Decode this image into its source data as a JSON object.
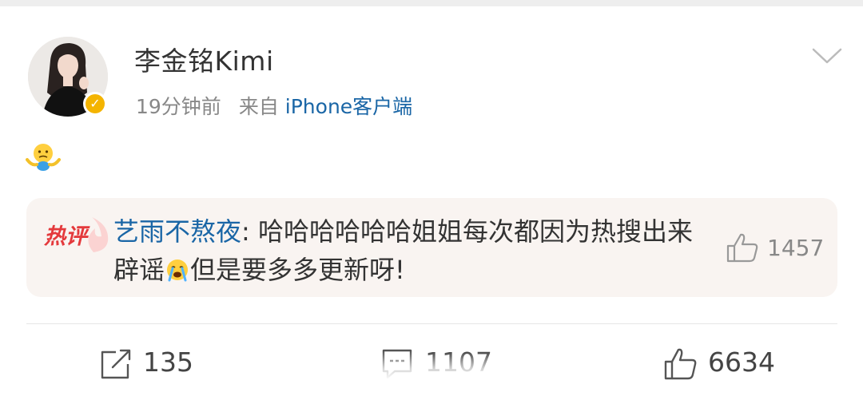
{
  "post": {
    "author": "李金铭Kimi",
    "time": "19分钟前",
    "source_prefix": "来自",
    "source": "iPhone客户端",
    "content_emoji": "shrug-emoji"
  },
  "hot_comment": {
    "label": "热评",
    "commenter": "艺雨不熬夜",
    "separator": ": ",
    "text_before_emoji": "哈哈哈哈哈哈姐姐每次都因为热搜出来辟谣",
    "text_after_emoji": "但是要多多更新呀!",
    "like_count": "1457"
  },
  "actions": {
    "repost_count": "135",
    "comment_count": "1107",
    "like_count": "6634"
  },
  "colors": {
    "link_blue": "#1a66a6",
    "hot_red": "#e4393c",
    "verified_gold": "#f4b400",
    "comment_bg": "#f9f4f1"
  }
}
